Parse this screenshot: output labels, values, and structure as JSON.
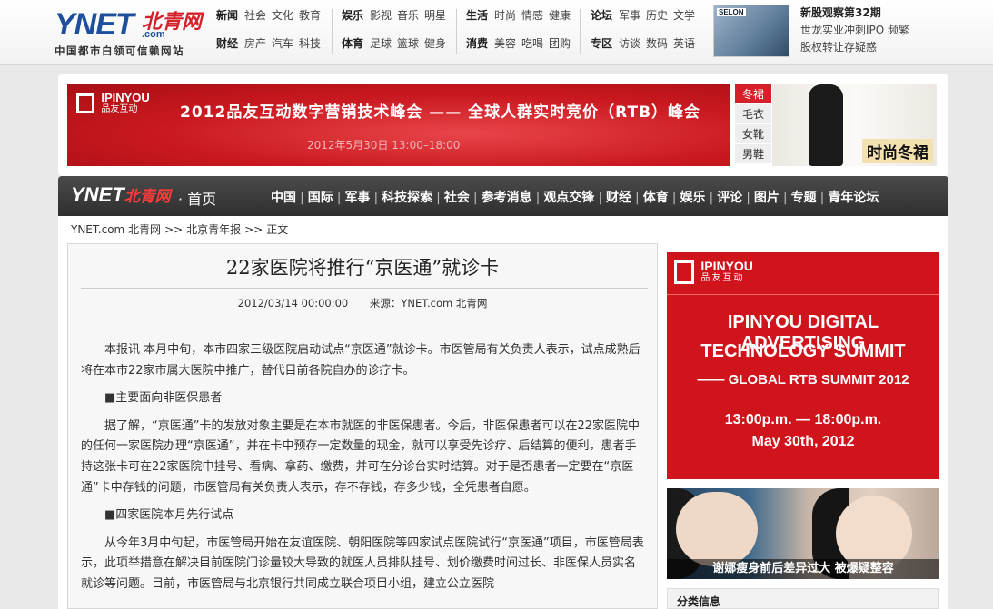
{
  "logo": {
    "ynet": "YNET",
    "beiqing": "北青网",
    "com": ".com",
    "slogan": "中国都市白领可信赖网站"
  },
  "topnav": [
    {
      "rows": [
        [
          "新闻",
          "社会",
          "文化",
          "教育"
        ],
        [
          "财经",
          "房产",
          "汽车",
          "科技"
        ]
      ]
    },
    {
      "rows": [
        [
          "娱乐",
          "影视",
          "音乐",
          "明星"
        ],
        [
          "体育",
          "足球",
          "篮球",
          "健身"
        ]
      ]
    },
    {
      "rows": [
        [
          "生活",
          "时尚",
          "情感",
          "健康"
        ],
        [
          "消费",
          "美容",
          "吃喝",
          "团购"
        ]
      ]
    },
    {
      "rows": [
        [
          "论坛",
          "军事",
          "历史",
          "文学"
        ],
        [
          "专区",
          "访谈",
          "数码",
          "英语"
        ]
      ]
    }
  ],
  "selon_brand": "SELON",
  "right_news": {
    "title": "新股观察第32期",
    "items": [
      "世龙实业冲刺IPO 频繁",
      "股权转让存疑惑"
    ]
  },
  "banner": {
    "logo_name": "IPINYOU",
    "logo_cn": "品友互动",
    "headline": "2012品友互动数字营销技术峰会 —— 全球人群实时竞价（RTB）峰会",
    "sub": "2012年5月30日 13:00–18:00"
  },
  "tags": [
    "冬裙",
    "毛衣",
    "女靴",
    "男鞋"
  ],
  "dress_label": "时尚冬裙",
  "channel_nav": {
    "logo": "YNET",
    "logo_cn": "北青网",
    "home": "· 首页",
    "items": [
      "中国",
      "国际",
      "军事",
      "科技探索",
      "社会",
      "参考消息",
      "观点交锋",
      "财经",
      "体育",
      "娱乐",
      "评论",
      "图片",
      "专题",
      "青年论坛"
    ]
  },
  "breadcrumb": [
    "YNET.com 北青网",
    ">>",
    "北京青年报",
    ">>",
    "正文"
  ],
  "article": {
    "title": "22家医院将推行“京医通”就诊卡",
    "date": "2012/03/14 00:00:00",
    "source": "来源：YNET.com 北青网",
    "paragraphs": [
      "本报讯 本月中旬，本市四家三级医院启动试点“京医通”就诊卡。市医管局有关负责人表示，试点成熟后将在本市22家市属大医院中推广，替代目前各院自办的诊疗卡。",
      "■主要面向非医保患者",
      "据了解，“京医通”卡的发放对象主要是在本市就医的非医保患者。今后，非医保患者可以在22家医院中的任何一家医院办理“京医通”，并在卡中预存一定数量的现金，就可以享受先诊疗、后结算的便利，患者手持这张卡可在22家医院中挂号、看病、拿药、缴费，并可在分诊台实时结算。对于是否患者一定要在“京医通”卡中存钱的问题，市医管局有关负责人表示，存不存钱，存多少钱，全凭患者自愿。",
      "■四家医院本月先行试点",
      "从今年3月中旬起，市医管局开始在友谊医院、朝阳医院等四家试点医院试行“京医通”项目，市医管局表示，此项举措意在解决目前医院门诊量较大导致的就医人员排队挂号、划价缴费时间过长、非医保人员实名就诊等问题。目前，市医管局与北京银行共同成立联合项目小组，建立公立医院"
    ]
  },
  "right_ad": {
    "logo_name": "IPINYOU",
    "logo_cn": "品友互动",
    "line1": "IPINYOU DIGITAL ADVERTISING",
    "line2": "TECHNOLOGY  SUMMIT",
    "line3": "—— GLOBAL RTB  SUMMIT 2012",
    "line4": "13:00p.m. — 18:00p.m.",
    "line5": "May 30th, 2012"
  },
  "photo_caption": "谢娜瘦身前后差异过大  被爆疑整容",
  "category_title": "分类信息",
  "colors": {
    "brand_red": "#d5202a",
    "brand_blue": "#1d4f9c",
    "nav_dark": "#3a3a3a"
  }
}
